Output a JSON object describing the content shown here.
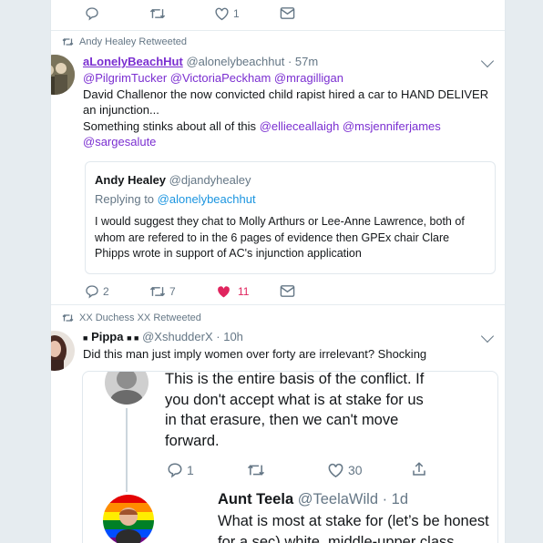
{
  "top_actions": {
    "like_count": "1"
  },
  "tweet1": {
    "retweeted_by": "Andy Healey Retweeted",
    "author_name": "aLonelyBeachHut",
    "author_handle": "@alonelybeachhut",
    "time": "57m",
    "mentions": "@PilgrimTucker @VictoriaPeckham @mragilligan",
    "text_line1": "David Challenor the now convicted child rapist hired a car to HAND DELIVER",
    "text_line2": "an injunction...",
    "text_line3": "Something stinks about all of this",
    "tail_mentions": "@ellieceallaigh @msjenniferjames",
    "last_mention": "@sargesalute",
    "quote": {
      "author_name": "Andy Healey",
      "author_handle": "@djandyhealey",
      "replying_to_label": "Replying to",
      "replying_to_handle": "@alonelybeachhut",
      "line1": "I would suggest they chat to Molly Arthurs or Lee-Anne Lawrence, both of",
      "line2": "whom are refered to in the 6 pages of evidence then GPEx chair Clare",
      "line3": "Phipps wrote in support of AC's injunction application"
    },
    "reply_count": "2",
    "retweet_count": "7",
    "like_count": "11",
    "like_color": "#e0245e"
  },
  "tweet2": {
    "retweeted_by": "XX Duchess XX Retweeted",
    "author_name": "Pippa",
    "author_handle": "@XshudderX",
    "time": "10h",
    "text": "Did this man just imply women over forty are irrelevant? Shocking",
    "embed": {
      "first_line1": "This is the entire basis of the conflict. If",
      "first_line2": "you don't accept what is at stake for us",
      "first_line3": "in that erasure, then we can't move",
      "first_line4": "forward.",
      "reply_count": "1",
      "like_count": "30",
      "second_author_name": "Aunt Teela",
      "second_author_handle": "@TeelaWild",
      "second_time": "1d",
      "second_line1": "What is most at stake for (let’s be honest",
      "second_line2": "for a sec) white, middle-upper class"
    }
  },
  "colors": {
    "link": "#1b95e0",
    "mention_purple": "#7b2fd1",
    "muted": "#657786"
  }
}
